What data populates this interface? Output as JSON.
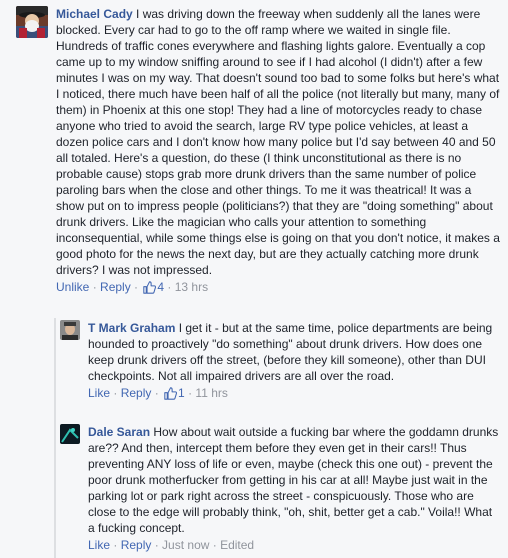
{
  "comments": [
    {
      "author": "Michael Cady",
      "text": "I was driving down the freeway when suddenly all the lanes were blocked. Every car had to go to the off ramp where we waited in single file. Hundreds of traffic cones everywhere and flashing lights galore. Eventually a cop came up to my window sniffing around to see if I had alcohol (I didn't) after a few minutes I was on my way. That doesn't sound too bad to some folks but here's what I noticed, there much have been half of all the police (not literally but many, many of them) in Phoenix at this one stop! They had a line of motorcycles ready to chase anyone who tried to avoid the search, large RV type police vehicles, at least a dozen police cars and I don't know how many police but I'd say between 40 and 50 all totaled. Here's a question, do these (I think unconstitutional as there is no probable cause) stops grab more drunk drivers than the same number of police paroling bars when the close and other things. To me it was theatrical! It was a show put on to impress people (politicians?) that they are \"doing something\" about drunk drivers. Like the magician who calls your attention to something inconsequential, while some things else is going on that you don't notice, it makes a good photo for the news the next day, but are they actually catching more drunk drivers? I was not impressed.",
      "actions": {
        "unlike": "Unlike",
        "reply": "Reply",
        "likes": "4",
        "time": "13 hrs"
      }
    },
    {
      "author": "T Mark Graham",
      "text": "I get it - but at the same time, police departments are being hounded to proactively \"do something\" about drunk drivers. How does one keep drunk drivers off the street, (before they kill someone), other than DUI checkpoints. Not all impaired drivers are all over the road.",
      "actions": {
        "like": "Like",
        "reply": "Reply",
        "likes": "1",
        "time": "11 hrs"
      }
    },
    {
      "author": "Dale Saran",
      "text": "How about wait outside a fucking bar where the goddamn drunks are?? And then, intercept them before they even get in their cars!! Thus preventing ANY loss of life or even, maybe (check this one out) - prevent the poor drunk motherfucker from getting in his car at all! Maybe just wait in the parking lot or park right across the street - conspicuously. Those who are close to the edge will probably think, \"oh, shit, better get a cab.\" Voila!! What a fucking concept.",
      "actions": {
        "like": "Like",
        "reply": "Reply",
        "time": "Just now",
        "edited": "Edited"
      }
    }
  ],
  "colors": {
    "link": "#4267b2",
    "author": "#365899",
    "meta": "#90949c"
  }
}
